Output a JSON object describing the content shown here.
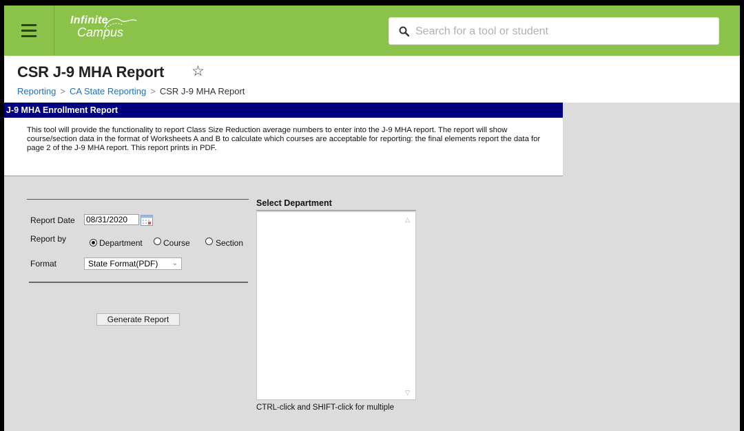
{
  "app": {
    "logo_line1": "Infinite",
    "logo_line2": "Campus",
    "search_placeholder": "Search for a tool or student"
  },
  "header": {
    "title": "CSR J-9 MHA Report",
    "favorite_glyph": "☆",
    "breadcrumb": [
      "Reporting",
      "CA State Reporting",
      "CSR J-9 MHA Report"
    ],
    "breadcrumb_sep": ">"
  },
  "section": {
    "title": "J-9 MHA Enrollment Report",
    "description": "This tool will provide the functionality to report Class Size Reduction average numbers to enter into the J-9 MHA report. The report will show course/section data in the format of Worksheets A and B to calculate which courses are acceptable for reporting: the final elements report the data for page 2 of the J-9 MHA report. This report prints in PDF."
  },
  "form": {
    "report_date_label": "Report Date",
    "report_date_value": "08/31/2020",
    "report_by_label": "Report by",
    "report_by_options": [
      "Department",
      "Course",
      "Section"
    ],
    "report_by_selected": "Department",
    "format_label": "Format",
    "format_value": "State Format(PDF)",
    "generate_label": "Generate Report"
  },
  "department": {
    "title": "Select Department",
    "items": [],
    "hint": "CTRL-click and SHIFT-click for multiple"
  },
  "colors": {
    "topbar": "#8bc34a",
    "section_bar": "#00007f",
    "link": "#1f6fb6",
    "background": "#dcdcdc"
  }
}
